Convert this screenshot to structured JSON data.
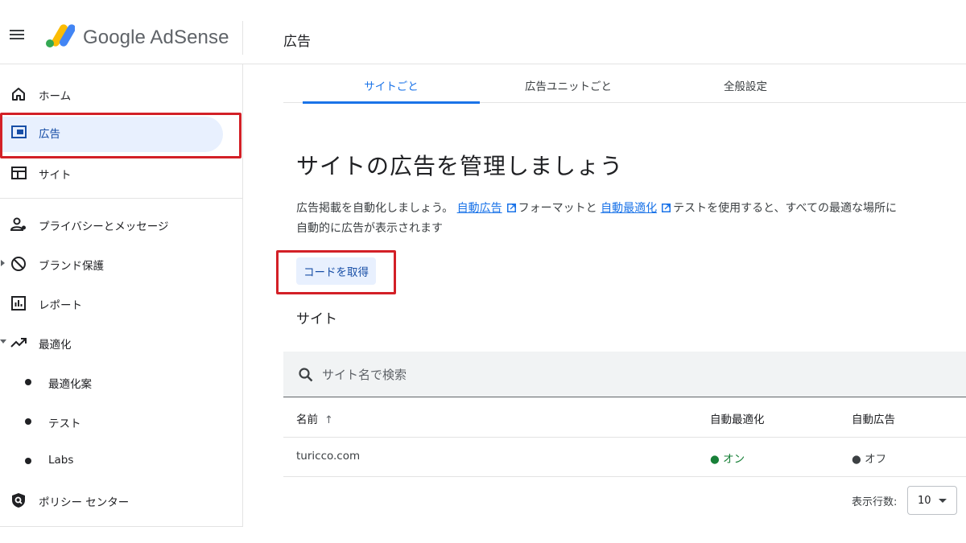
{
  "app": {
    "brand": "Google AdSense",
    "page_title": "広告"
  },
  "sidebar": {
    "items": [
      {
        "label": "ホーム",
        "icon": "home-icon"
      },
      {
        "label": "広告",
        "icon": "ads-icon"
      },
      {
        "label": "サイト",
        "icon": "sites-icon"
      },
      {
        "label": "プライバシーとメッセージ",
        "icon": "privacy-icon"
      },
      {
        "label": "ブランド保護",
        "icon": "block-icon"
      },
      {
        "label": "レポート",
        "icon": "report-icon"
      },
      {
        "label": "最適化",
        "icon": "trending-up-icon"
      },
      {
        "label": "最適化案",
        "icon": "dot"
      },
      {
        "label": "テスト",
        "icon": "dot"
      },
      {
        "label": "Labs",
        "icon": "dot"
      },
      {
        "label": "ポリシー センター",
        "icon": "policy-icon"
      }
    ]
  },
  "tabs": [
    {
      "label": "サイトごと"
    },
    {
      "label": "広告ユニットごと"
    },
    {
      "label": "全般設定"
    }
  ],
  "main": {
    "hero": "サイトの広告を管理しましょう",
    "desc_pre": "広告掲載を自動化しましょう。",
    "link_auto_ads": "自動広告",
    "desc_mid": "フォーマットと",
    "link_auto_opt": "自動最適化",
    "desc_post": "テストを使用すると、すべての最適な場所に自動的に広告が表示されます",
    "get_code": "コードを取得",
    "section_title": "サイト"
  },
  "search": {
    "placeholder": "サイト名で検索"
  },
  "table": {
    "headers": [
      "名前",
      "自動最適化",
      "自動広告"
    ],
    "sort_arrow": "↑",
    "rows": [
      {
        "name": "turicco.com",
        "auto_opt": "● オン",
        "auto_ads": "● オフ"
      }
    ]
  },
  "pagination": {
    "rows_label": "表示行数:",
    "rows_value": "10"
  },
  "colors": {
    "accent": "#1a73e8",
    "active_bg": "#e8f0fe",
    "highlight_red": "#d32027",
    "status_on": "#188038"
  }
}
